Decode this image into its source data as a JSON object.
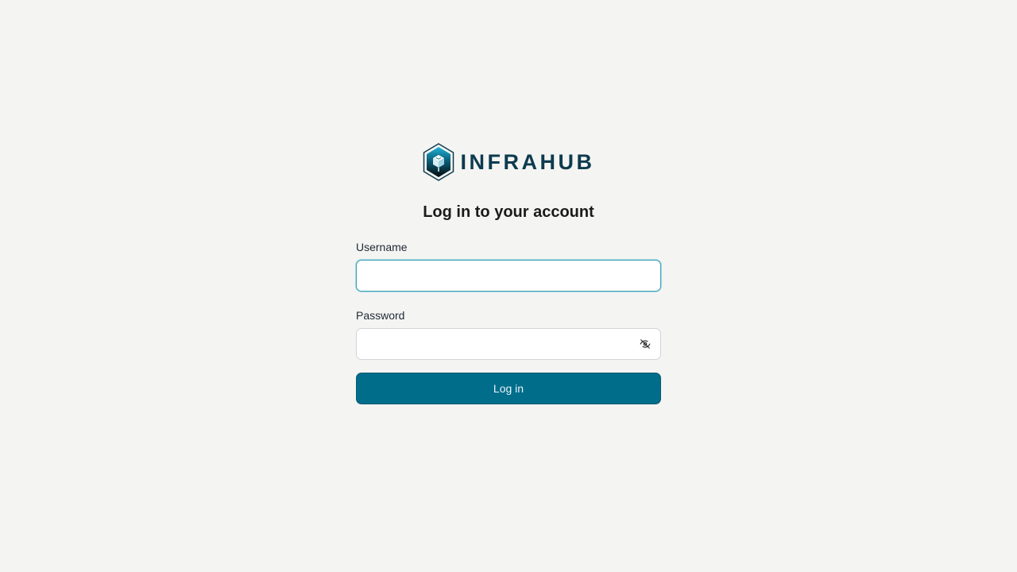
{
  "brand": {
    "wordmark": "INFRAHUB",
    "logo_icon": "infrahub-hexagon-logo",
    "color": "#0d3b4f"
  },
  "login": {
    "title": "Log in to your account",
    "username": {
      "label": "Username",
      "value": "",
      "focused": true
    },
    "password": {
      "label": "Password",
      "value": "",
      "toggle_icon": "eye-off-icon"
    },
    "submit_label": "Log in"
  },
  "colors": {
    "background": "#f4f4f2",
    "primary": "#006d8b",
    "focus_ring": "#3f9fb5"
  }
}
